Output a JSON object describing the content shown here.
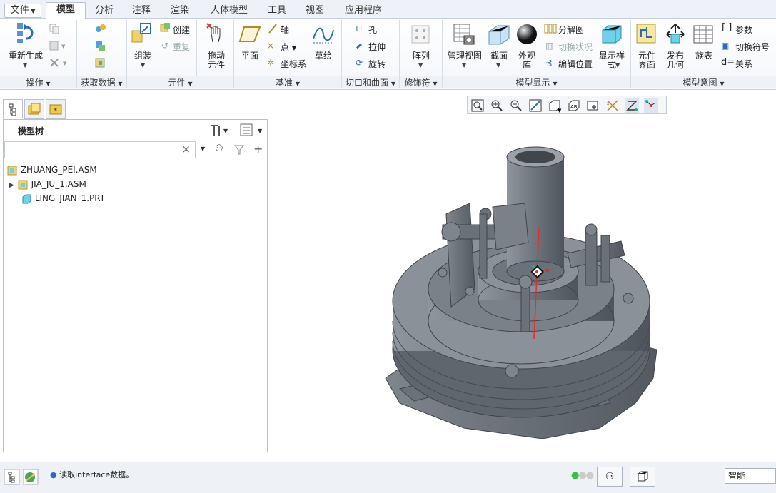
{
  "menu": {
    "file": "文件",
    "tabs": [
      "模型",
      "分析",
      "注释",
      "渲染",
      "人体模型",
      "工具",
      "视图",
      "应用程序"
    ]
  },
  "ribbon": {
    "ops": {
      "regen": "重新生成"
    },
    "get_data": {},
    "component": {
      "assemble": "组装",
      "create": "创建",
      "repeat": "重复"
    },
    "drag": {
      "label": "拖动\n元件"
    },
    "datum": {
      "plane": "平面",
      "axis": "轴",
      "point": "点",
      "csys": "坐标系",
      "sketch": "草绘"
    },
    "cut": {
      "hole": "孔",
      "extrude": "拉伸",
      "revolve": "旋转"
    },
    "pattern": {
      "label": "阵列"
    },
    "display": {
      "manage_views": "管理视图",
      "section": "截面",
      "appearance": "外观\n库",
      "explode": "分解图",
      "toggle_state": "切换状况",
      "edit_pos": "编辑位置",
      "display_style": "显示样\n式"
    },
    "intent": {
      "comp_interface": "元件\n界面",
      "publish_geom": "发布\n几何",
      "family_table": "族表",
      "params": "参数",
      "switch_symbols": "切换符号",
      "relations": "关系"
    },
    "groups": {
      "operations": "操作",
      "get_data": "获取数据",
      "component": "元件",
      "datum": "基准",
      "cut_surface": "切口和曲面",
      "modifier": "修饰符",
      "model_display": "模型显示",
      "model_intent": "模型意图"
    }
  },
  "panel": {
    "title": "模型树",
    "search_value": "",
    "clear": "×",
    "tree": [
      "ZHUANG_PEI.ASM",
      "JIA_JU_1.ASM",
      "LING_JIAN_1.PRT"
    ]
  },
  "status": {
    "message": "读取interface数据。",
    "filter": "智能"
  },
  "colors": {
    "accent": "#2a6bbf",
    "model": "#6d747c"
  }
}
